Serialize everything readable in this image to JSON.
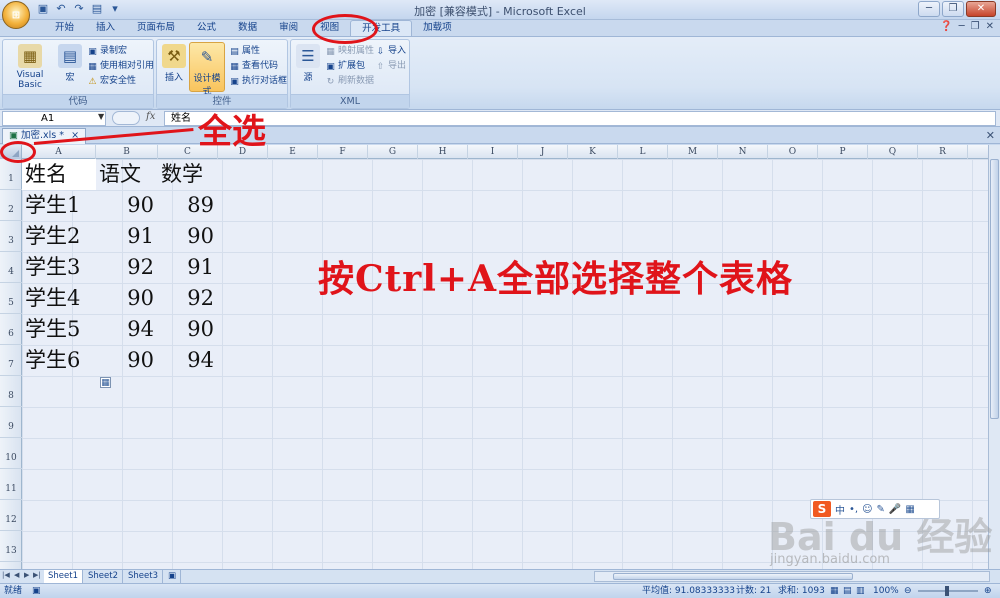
{
  "titlebar": {
    "title": "加密  [兼容模式] - Microsoft Excel",
    "office_button": "⊞"
  },
  "tabs": [
    "开始",
    "插入",
    "页面布局",
    "公式",
    "数据",
    "审阅",
    "视图",
    "开发工具",
    "加载项"
  ],
  "active_tab": "开发工具",
  "ribbon": {
    "code_group": {
      "label": "代码",
      "visual_basic": "Visual Basic",
      "macros": "宏",
      "record_macro": "录制宏",
      "relative_refs": "使用相对引用",
      "macro_security": "宏安全性"
    },
    "controls_group": {
      "label": "控件",
      "insert": "插入",
      "design_mode": "设计模式",
      "properties": "属性",
      "view_code": "查看代码",
      "run_dialog": "执行对话框"
    },
    "xml_group": {
      "label": "XML",
      "source": "源",
      "map_properties": "映射属性",
      "expansion_packs": "扩展包",
      "refresh_data": "刷新数据",
      "import": "导入",
      "export": "导出"
    }
  },
  "formula_bar": {
    "name_box": "A1",
    "fx": "fx",
    "content": "姓名"
  },
  "workbook_tab": "加密.xls *",
  "columns": [
    "A",
    "B",
    "C",
    "D",
    "E",
    "F",
    "G",
    "H",
    "I",
    "J",
    "K",
    "L",
    "M",
    "N",
    "O",
    "P",
    "Q",
    "R"
  ],
  "rows": [
    "1",
    "2",
    "3",
    "4",
    "5",
    "6",
    "7",
    "8",
    "9",
    "10",
    "11",
    "12",
    "13"
  ],
  "table": {
    "header": [
      "姓名",
      "语文",
      "数学"
    ],
    "rows": [
      [
        "学生1",
        "90",
        "89"
      ],
      [
        "学生2",
        "91",
        "90"
      ],
      [
        "学生3",
        "92",
        "91"
      ],
      [
        "学生4",
        "90",
        "92"
      ],
      [
        "学生5",
        "94",
        "90"
      ],
      [
        "学生6",
        "90",
        "94"
      ]
    ]
  },
  "sheets": [
    "Sheet1",
    "Sheet2",
    "Sheet3"
  ],
  "active_sheet": "Sheet1",
  "status": {
    "ready": "就绪",
    "average": "平均值: 91.08333333",
    "count": "计数: 21",
    "sum": "求和: 1093",
    "zoom": "100%"
  },
  "annotations": {
    "select_all": "全选",
    "instruction": "按Ctrl+A全部选择整个表格",
    "color": "#e0141a"
  },
  "watermark": {
    "logo": "Bai du 经验",
    "url": "jingyan.baidu.com"
  },
  "ime": {
    "logo": "S",
    "mode": "中"
  }
}
